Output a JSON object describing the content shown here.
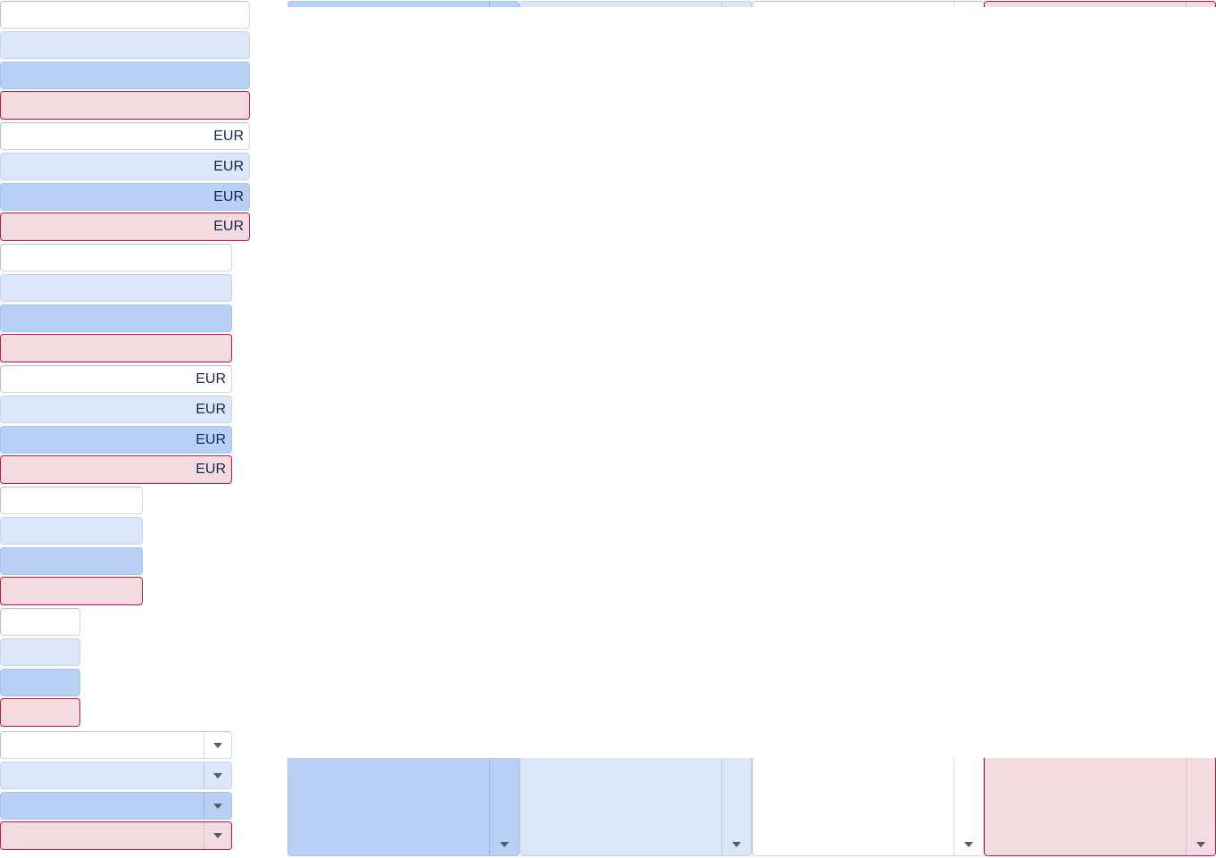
{
  "currency_suffix": "EUR",
  "states": [
    "normal",
    "hover",
    "focus",
    "error"
  ],
  "colors": {
    "normal_bg": "#ffffff",
    "hover_bg": "#dbe6f8",
    "focus_bg": "#b8d0f4",
    "error_bg": "#f4dbe1",
    "error_border": "#c2184b",
    "suffix_text": "#14294d"
  },
  "icons": {
    "dropdown": "chevron-down-icon"
  }
}
